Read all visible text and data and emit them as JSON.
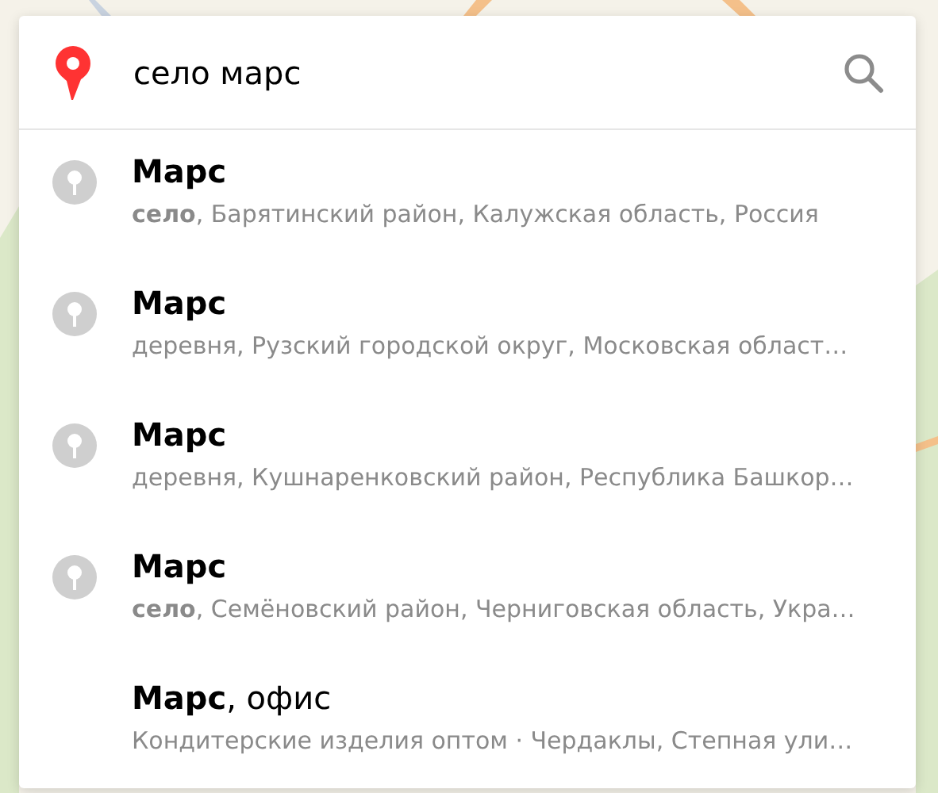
{
  "search": {
    "value": "село марс"
  },
  "suggestions": [
    {
      "kind": "place",
      "title": "Марс",
      "subtitle": "**село**, Барятинский район, Калужская область, Россия"
    },
    {
      "kind": "place",
      "title": "Марс",
      "subtitle": "деревня, Рузский городской округ, Московская област…"
    },
    {
      "kind": "place",
      "title": "Марс",
      "subtitle": "деревня, Кушнаренковский район, Республика Башкор…"
    },
    {
      "kind": "place",
      "title": "Марс",
      "subtitle": "**село**, Семёновский район, Черниговская область, Укра…"
    },
    {
      "kind": "business",
      "title": "**Марс**, офис",
      "subtitle": "Кондитерские изделия оптом · Чердаклы, Степная ули…"
    }
  ]
}
